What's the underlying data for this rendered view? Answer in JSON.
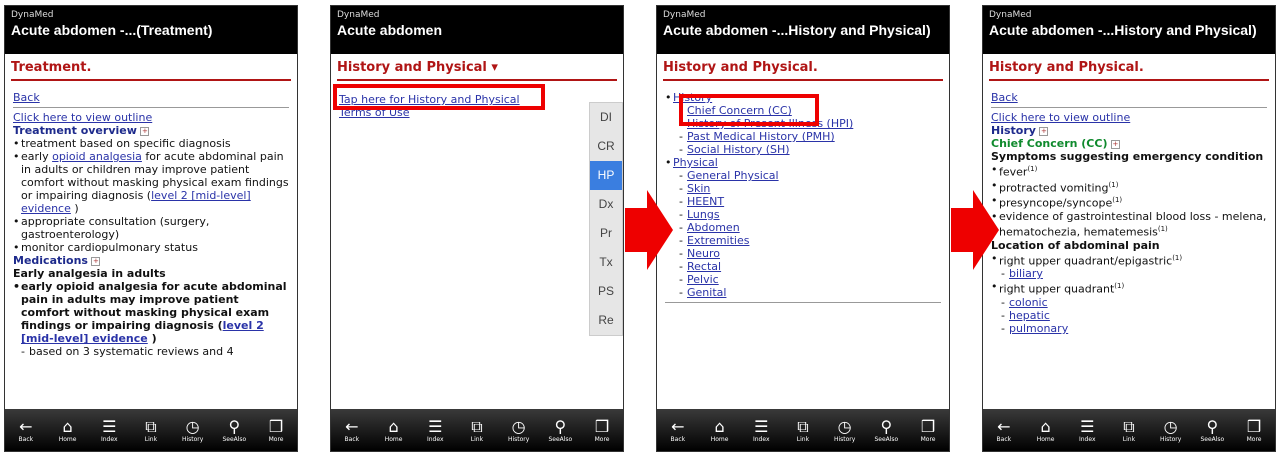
{
  "app_name": "DynaMed",
  "toolbar": [
    {
      "icon": "back-arrow-icon",
      "label": "Back"
    },
    {
      "icon": "home-icon",
      "label": "Home"
    },
    {
      "icon": "index-icon",
      "label": "Index"
    },
    {
      "icon": "link-icon",
      "label": "Link"
    },
    {
      "icon": "history-icon",
      "label": "History"
    },
    {
      "icon": "see-also-icon",
      "label": "SeeAlso"
    },
    {
      "icon": "more-icon",
      "label": "More"
    }
  ],
  "screen1": {
    "title": "Acute abdomen -...(Treatment)",
    "section": "Treatment.",
    "back": "Back",
    "outline": "Click here to view outline",
    "overview": "Treatment overview",
    "items": [
      "treatment based on specific diagnosis",
      "appropriate consultation (surgery, gastroenterology)",
      "monitor cardiopulmonary status"
    ],
    "item2_pre": "early ",
    "item2_link": "opioid analgesia",
    "item2_post": " for acute abdominal pain in adults or children may improve patient comfort without masking physical exam findings or impairing diagnosis (",
    "item2_link2": "level 2 [mid-level] evidence",
    "item2_end": " )",
    "medications": "Medications",
    "early": "Early analgesia in adults",
    "bold_item": "early opioid analgesia for acute abdominal pain in adults may improve patient comfort without masking physical exam findings or impairing diagnosis (",
    "bold_link": "level 2 [mid-level] evidence",
    "bold_end": " )",
    "sub": "based on 3 systematic reviews and 4"
  },
  "screen2": {
    "title": "Acute abdomen",
    "section": "History and Physical ▾",
    "link1": "Tap here for History and Physical",
    "link2": "Terms of Use",
    "index": [
      "DI",
      "CR",
      "HP",
      "Dx",
      "Pr",
      "Tx",
      "PS",
      "Re"
    ]
  },
  "screen3": {
    "title": "Acute abdomen -...History and Physical)",
    "section": "History and Physical.",
    "history": "History",
    "history_items": [
      "Chief Concern (CC)",
      "History of Present Illness (HPI)",
      "Past Medical History (PMH)",
      "Social History (SH)"
    ],
    "physical": "Physical",
    "physical_items": [
      "General Physical",
      "Skin",
      "HEENT",
      "Lungs",
      "Abdomen",
      "Extremities",
      "Neuro",
      "Rectal",
      "Pelvic",
      "Genital"
    ]
  },
  "screen4": {
    "title": "Acute abdomen -...History and Physical)",
    "section": "History and Physical.",
    "back": "Back",
    "outline": "Click here to view outline",
    "history": "History",
    "cc": "Chief Concern (CC)",
    "symptoms": "Symptoms suggesting emergency condition",
    "items": [
      "fever",
      "protracted vomiting",
      "presyncope/syncope",
      "evidence of gastrointestinal blood loss - melena, hematochezia, hematemesis"
    ],
    "ref": "(1)",
    "location": "Location of abdominal pain",
    "ruq_epi": "right upper quadrant/epigastric",
    "biliary": "biliary",
    "ruq": "right upper quadrant",
    "ruq_items": [
      "colonic",
      "hepatic",
      "pulmonary"
    ]
  }
}
